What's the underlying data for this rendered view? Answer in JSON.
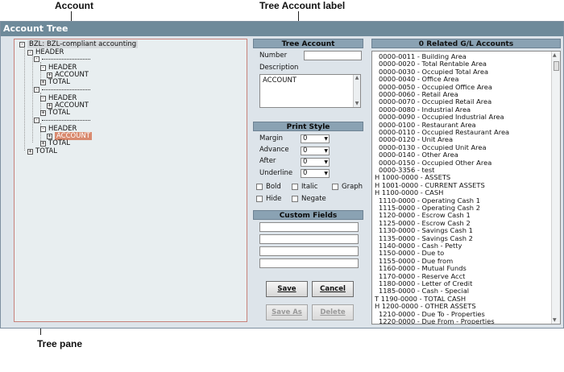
{
  "callouts": {
    "account": "Account",
    "tree_account_label": "Tree Account label",
    "tree_pane": "Tree pane"
  },
  "window": {
    "title": "Account Tree"
  },
  "tree": {
    "nodes": [
      {
        "label": "BZL: BZL-compliant accounting",
        "expander": "-",
        "style": "root"
      },
      {
        "label": "HEADER",
        "expander": "-"
      },
      {
        "label": "-----------------",
        "expander": "-",
        "separator": true
      },
      {
        "label": "HEADER",
        "expander": "-"
      },
      {
        "label": "ACCOUNT",
        "expander": "+"
      },
      {
        "label": "TOTAL",
        "expander": "+"
      },
      {
        "label": "-----------------",
        "expander": "-",
        "separator": true
      },
      {
        "label": "HEADER",
        "expander": "-"
      },
      {
        "label": "ACCOUNT",
        "expander": "+"
      },
      {
        "label": "TOTAL",
        "expander": "+"
      },
      {
        "label": "-----------------",
        "expander": "-",
        "separator": true
      },
      {
        "label": "HEADER",
        "expander": "-"
      },
      {
        "label": "ACCOUNT",
        "expander": "+",
        "style": "selected"
      },
      {
        "label": "TOTAL",
        "expander": "+"
      },
      {
        "label": "TOTAL",
        "expander": "+"
      }
    ]
  },
  "tree_account": {
    "header": "Tree Account",
    "number_label": "Number",
    "number_value": "",
    "description_label": "Description",
    "description_value": "ACCOUNT"
  },
  "print_style": {
    "header": "Print Style",
    "fields": [
      {
        "label": "Margin",
        "value": "0"
      },
      {
        "label": "Advance",
        "value": "0"
      },
      {
        "label": "After",
        "value": "0"
      },
      {
        "label": "Underline",
        "value": "0"
      }
    ],
    "checkboxes": [
      {
        "label": "Bold",
        "checked": false
      },
      {
        "label": "Italic",
        "checked": false
      },
      {
        "label": "Graph",
        "checked": false
      },
      {
        "label": "Hide",
        "checked": false
      },
      {
        "label": "Negate",
        "checked": false
      }
    ]
  },
  "custom_fields": {
    "header": "Custom Fields",
    "values": [
      "",
      "",
      "",
      ""
    ]
  },
  "buttons": {
    "save": "Save",
    "cancel": "Cancel",
    "save_as": "Save As",
    "delete": "Delete"
  },
  "related": {
    "header": "0 Related G/L Accounts",
    "rows": [
      "0000-0011 - Building Area",
      "0000-0020 - Total Rentable Area",
      "0000-0030 - Occupied Total Area",
      "0000-0040 - Office Area",
      "0000-0050 - Occupied Office Area",
      "0000-0060 - Retail Area",
      "0000-0070 - Occupied Retail Area",
      "0000-0080 - Industrial Area",
      "0000-0090 - Occupied Industrial Area",
      "0000-0100 - Restaurant Area",
      "0000-0110 - Occupied Restaurant Area",
      "0000-0120 - Unit Area",
      "0000-0130 - Occupied Unit Area",
      "0000-0140 - Other Area",
      "0000-0150 - Occupied Other Area",
      "0000-3356 - test",
      "H 1000-0000 - ASSETS",
      "H 1001-0000 - CURRENT ASSETS",
      "H 1100-0000 - CASH",
      "1110-0000 - Operating Cash 1",
      "1115-0000 - Operating Cash 2",
      "1120-0000 - Escrow Cash 1",
      "1125-0000 - Escrow Cash 2",
      "1130-0000 - Savings Cash 1",
      "1135-0000 - Savings Cash 2",
      "1140-0000 - Cash - Petty",
      "1150-0000 - Due to",
      "1155-0000 - Due from",
      "1160-0000 - Mutual Funds",
      "1170-0000 - Reserve Acct",
      "1180-0000 - Letter of Credit",
      "1185-0000 - Cash - Special",
      "T 1190-0000 - TOTAL CASH",
      "H 1200-0000 - OTHER ASSETS",
      "1210-0000 - Due To - Properties",
      "1220-0000 - Due From - Properties"
    ]
  },
  "icons": {
    "expand": "plus-box-icon",
    "collapse": "minus-box-icon",
    "dropdown": "triangle-down-icon"
  }
}
